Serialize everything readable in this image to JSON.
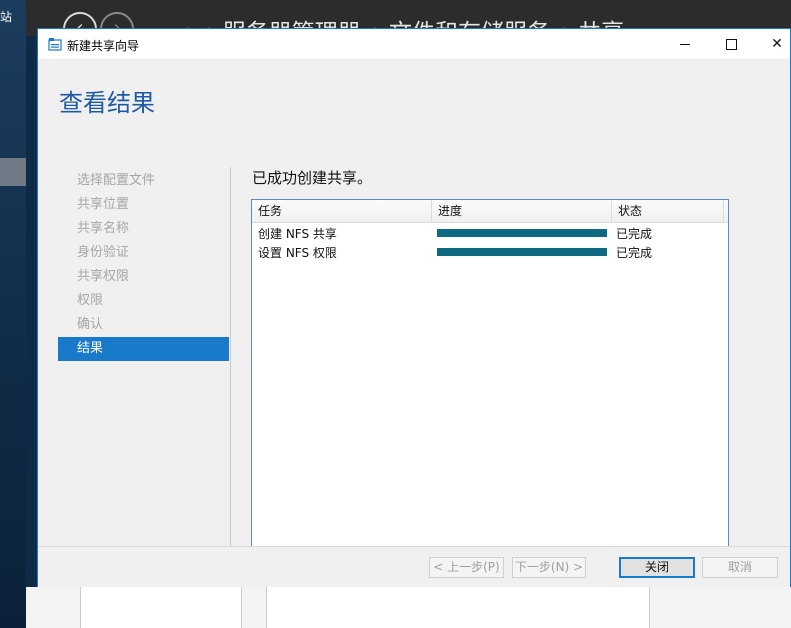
{
  "background": {
    "desktop_label": "站",
    "server_manager": {
      "back_glyph": "‹",
      "forward_glyph": "›",
      "breadcrumb": "• • 服务器管理器 • 文件和存储服务 • 共享"
    }
  },
  "dialog": {
    "title": "新建共享向导",
    "icon": "share-wizard-icon",
    "window_controls": [
      "minimize",
      "maximize",
      "close"
    ],
    "close_glyph": "✕",
    "page_title": "查看结果",
    "steps": [
      {
        "label": "选择配置文件",
        "active": false
      },
      {
        "label": "共享位置",
        "active": false
      },
      {
        "label": "共享名称",
        "active": false
      },
      {
        "label": "身份验证",
        "active": false
      },
      {
        "label": "共享权限",
        "active": false
      },
      {
        "label": "权限",
        "active": false
      },
      {
        "label": "确认",
        "active": false
      },
      {
        "label": "结果",
        "active": true
      }
    ],
    "message": "已成功创建共享。",
    "table": {
      "headers": [
        "任务",
        "进度",
        "状态"
      ],
      "rows": [
        {
          "task": "创建 NFS 共享",
          "progress": 1.0,
          "status": "已完成"
        },
        {
          "task": "设置 NFS 权限",
          "progress": 1.0,
          "status": "已完成"
        }
      ]
    },
    "buttons": {
      "prev": "< 上一步(P)",
      "next": "下一步(N) >",
      "close": "关闭",
      "cancel": "取消"
    }
  },
  "colors": {
    "accent": "#1979ca",
    "title_blue": "#1f5aa6",
    "progress": "#0e6a83"
  }
}
